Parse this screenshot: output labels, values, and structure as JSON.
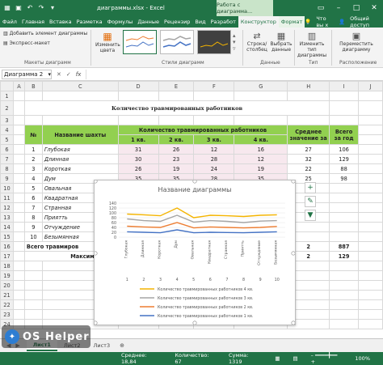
{
  "titlebar": {
    "document": "диаграммы.xlsx - Excel",
    "context_group": "Работа с диаграмма...",
    "qa_icons": [
      "save-icon",
      "undo-icon",
      "redo-icon",
      "qa-dropdown-icon"
    ],
    "window_icons": [
      "ribbon-options-icon",
      "minimize-icon",
      "maximize-icon",
      "close-icon"
    ]
  },
  "tabs": [
    "Файл",
    "Главная",
    "Вставка",
    "Разметка",
    "Формулы",
    "Данные",
    "Рецензир",
    "Вид",
    "Разработ",
    "Конструктор",
    "Формат"
  ],
  "tabs_right": {
    "help": "Что вы х",
    "account": "Общий доступ"
  },
  "ribbon": {
    "add_element": "Добавить элемент диаграммы",
    "express": "Экспресс-макет",
    "change_colors": "Изменить цвета",
    "group_layouts": "Макеты диаграмм",
    "group_styles": "Стили диаграмм",
    "row_col": "Строка/ столбец",
    "select_data": "Выбрать данные",
    "group_data": "Данные",
    "change_type": "Изменить тип диаграммы",
    "group_type": "Тип",
    "move_chart": "Переместить диаграмму",
    "group_location": "Расположение"
  },
  "formula_bar": {
    "name_box": "Диаграмма 2",
    "fx": "fx",
    "cancel": "✕",
    "enter": "✓"
  },
  "sheet": {
    "columns": [
      "A",
      "B",
      "C",
      "D",
      "E",
      "F",
      "G",
      "H",
      "I",
      "J"
    ],
    "title": "Количество травмированных работников",
    "head_no": "№",
    "head_name": "Название шахты",
    "head_group": "Количество травмированных работников",
    "head_avg": "Среднее значение за",
    "head_total": "Всего за год",
    "quarters": [
      "1 кв.",
      "2 кв.",
      "3 кв.",
      "4 кв."
    ],
    "rows": [
      {
        "n": "1",
        "name": "Глубокая",
        "q": [
          "31",
          "26",
          "12",
          "16"
        ],
        "avg": "27",
        "total": "106"
      },
      {
        "n": "2",
        "name": "Длинная",
        "q": [
          "30",
          "23",
          "28",
          "12"
        ],
        "avg": "32",
        "total": "129"
      },
      {
        "n": "3",
        "name": "Короткая",
        "q": [
          "26",
          "19",
          "24",
          "19"
        ],
        "avg": "22",
        "total": "88"
      },
      {
        "n": "4",
        "name": "Дум",
        "q": [
          "35",
          "35",
          "28",
          "35"
        ],
        "avg": "25",
        "total": "98"
      },
      {
        "n": "5",
        "name": "Овальная",
        "q": [
          "",
          "",
          "",
          "",
          ""
        ],
        "avg": "",
        "total": ""
      },
      {
        "n": "6",
        "name": "Квадратная",
        "q": [
          "",
          "",
          "",
          ""
        ],
        "avg": "",
        "total": ""
      },
      {
        "n": "7",
        "name": "Странная",
        "q": [
          "",
          "",
          "",
          ""
        ],
        "avg": "",
        "total": ""
      },
      {
        "n": "8",
        "name": "Приятть",
        "q": [
          "",
          "",
          "",
          ""
        ],
        "avg": "",
        "total": ""
      },
      {
        "n": "9",
        "name": "Отчуждение",
        "q": [
          "",
          "",
          "",
          ""
        ],
        "avg": "",
        "total": ""
      },
      {
        "n": "10",
        "name": "Безымянная",
        "q": [
          "",
          "",
          "",
          ""
        ],
        "avg": "",
        "total": ""
      }
    ],
    "total_label": "Всего травмиров",
    "total_value": "887",
    "total_avg": "2",
    "max_label": "Максимальное",
    "max_value": "129",
    "max_avg": "2",
    "row_numbers": [
      "1",
      "2",
      "3",
      "4",
      "5",
      "6",
      "7",
      "8",
      "9",
      "10",
      "11",
      "12",
      "13",
      "14",
      "15",
      "16",
      "17",
      "18",
      "19",
      "20",
      "21",
      "22",
      "23",
      "24"
    ]
  },
  "chart_data": {
    "type": "line",
    "title": "Название диаграммы",
    "categories": [
      "Глубокая",
      "Длинная",
      "Короткая",
      "Дум",
      "Овальная",
      "Квадратная",
      "Странная",
      "Приятть",
      "Отчуждение",
      "Безымянная"
    ],
    "category_numbers": [
      "1",
      "2",
      "3",
      "4",
      "5",
      "6",
      "7",
      "8",
      "9",
      "10"
    ],
    "ylim": [
      0,
      140
    ],
    "yticks": [
      "0",
      "20",
      "40",
      "60",
      "80",
      "100",
      "120",
      "140"
    ],
    "series": [
      {
        "name": "Количество травмированных работников 4 кв.",
        "color": "#f4b400",
        "values": [
          95,
          92,
          88,
          120,
          80,
          90,
          88,
          85,
          90,
          92
        ]
      },
      {
        "name": "Количество травмированных работников 3 кв.",
        "color": "#a5a5a5",
        "values": [
          75,
          68,
          65,
          90,
          62,
          68,
          65,
          60,
          66,
          68
        ]
      },
      {
        "name": "Количество травмированных работников 2 кв.",
        "color": "#ed7d31",
        "values": [
          45,
          42,
          40,
          60,
          38,
          42,
          40,
          38,
          40,
          44
        ]
      },
      {
        "name": "Количество травмированных работников 1 кв.",
        "color": "#4472c4",
        "values": [
          22,
          20,
          18,
          30,
          18,
          20,
          19,
          18,
          20,
          22
        ]
      }
    ]
  },
  "chart_tools": [
    "plus-icon",
    "brush-icon",
    "filter-icon"
  ],
  "sheet_tabs": [
    "Лист1",
    "Лист2",
    "Лист3"
  ],
  "status": {
    "avg": "Среднее: 18,84",
    "count": "Количество: 67",
    "sum": "Сумма: 1319",
    "zoom": "100%"
  },
  "watermark": "OS Helper"
}
